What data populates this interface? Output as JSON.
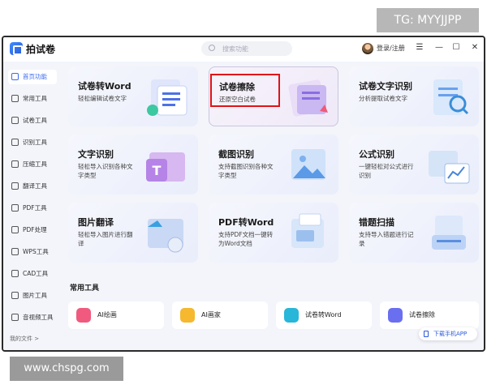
{
  "watermarks": {
    "top": "TG: MYYJJPP",
    "bottom": "www.chspg.com"
  },
  "app": {
    "title": "拍试卷"
  },
  "header": {
    "search_placeholder": "搜索功能",
    "login": "登录/注册"
  },
  "sidebar": {
    "items": [
      {
        "label": "首页功能",
        "icon": "home-icon"
      },
      {
        "label": "常用工具",
        "icon": "layers-icon"
      },
      {
        "label": "试卷工具",
        "icon": "paper-icon"
      },
      {
        "label": "识别工具",
        "icon": "scan-icon"
      },
      {
        "label": "压缩工具",
        "icon": "compress-icon"
      },
      {
        "label": "翻译工具",
        "icon": "translate-icon"
      },
      {
        "label": "PDF工具",
        "icon": "pdf-icon"
      },
      {
        "label": "PDF处理",
        "icon": "pdf-process-icon"
      },
      {
        "label": "WPS工具",
        "icon": "wps-icon"
      },
      {
        "label": "CAD工具",
        "icon": "cad-icon"
      },
      {
        "label": "图片工具",
        "icon": "image-icon"
      },
      {
        "label": "音视频工具",
        "icon": "media-icon"
      }
    ],
    "footer": "我的文件 >"
  },
  "cards": [
    {
      "title": "试卷转Word",
      "desc": "轻松编辑试卷文字"
    },
    {
      "title": "试卷擦除",
      "desc": "还原空白试卷"
    },
    {
      "title": "试卷文字识别",
      "desc": "分析提取试卷文字"
    },
    {
      "title": "文字识别",
      "desc": "轻松导入识别各种文字类型"
    },
    {
      "title": "截图识别",
      "desc": "支持截图识别各种文字类型"
    },
    {
      "title": "公式识别",
      "desc": "一键轻松对公式进行识别"
    },
    {
      "title": "图片翻译",
      "desc": "轻松导入图片进行翻译"
    },
    {
      "title": "PDF转Word",
      "desc": "支持PDF文档一键转为Word文档"
    },
    {
      "title": "错题扫描",
      "desc": "支持导入错题进行记录"
    }
  ],
  "section": {
    "common_tools": "常用工具"
  },
  "tools": [
    {
      "label": "AI绘画",
      "color": "#f05a7e"
    },
    {
      "label": "AI画家",
      "color": "#f5b82e"
    },
    {
      "label": "试卷转Word",
      "color": "#28b6d9"
    },
    {
      "label": "试卷擦除",
      "color": "#6a6ff0"
    }
  ],
  "download_app": "下载手机APP",
  "colors": {
    "accent": "#3b6cf0",
    "highlight_box": "#e0121a"
  }
}
